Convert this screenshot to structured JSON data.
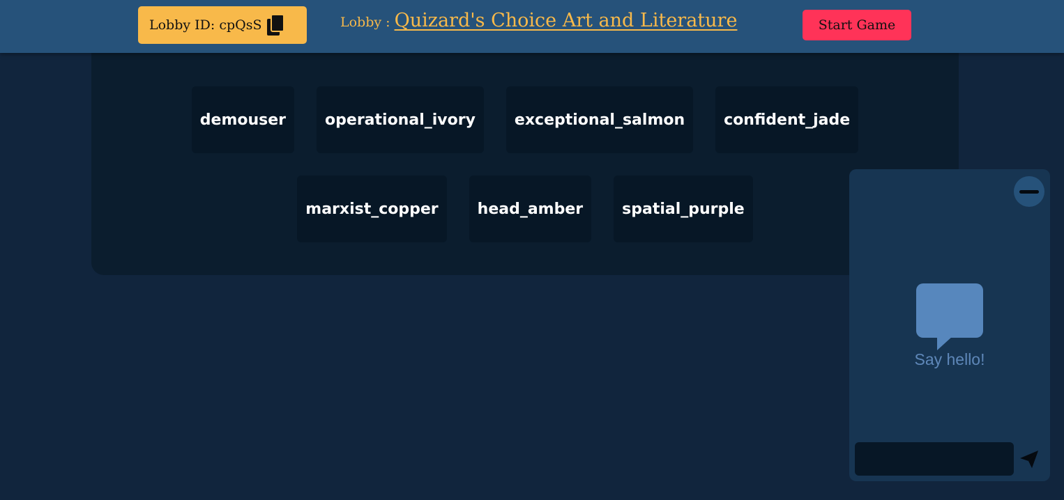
{
  "header": {
    "lobby_id_label": "Lobby ID: cpQsS",
    "lobby_prefix": "Lobby :",
    "lobby_name": "Quizard's Choice Art and Literature",
    "start_label": "Start Game"
  },
  "players": {
    "row1": [
      "demouser",
      "operational_ivory",
      "exceptional_salmon",
      "confident_jade"
    ],
    "row2": [
      "marxist_copper",
      "head_amber",
      "spatial_purple"
    ]
  },
  "chat": {
    "empty_text": "Say hello!",
    "input_placeholder": "",
    "input_value": "",
    "icons": {
      "minimize": "minimize-icon",
      "bubble": "chat-bubble-icon",
      "send": "send-icon",
      "copy": "copy-icon"
    }
  },
  "colors": {
    "accent": "#f8b94a",
    "start_button": "#ff3358",
    "header_bg": "#26527a",
    "page_bg": "#11253d",
    "bubble": "#5787bd"
  }
}
